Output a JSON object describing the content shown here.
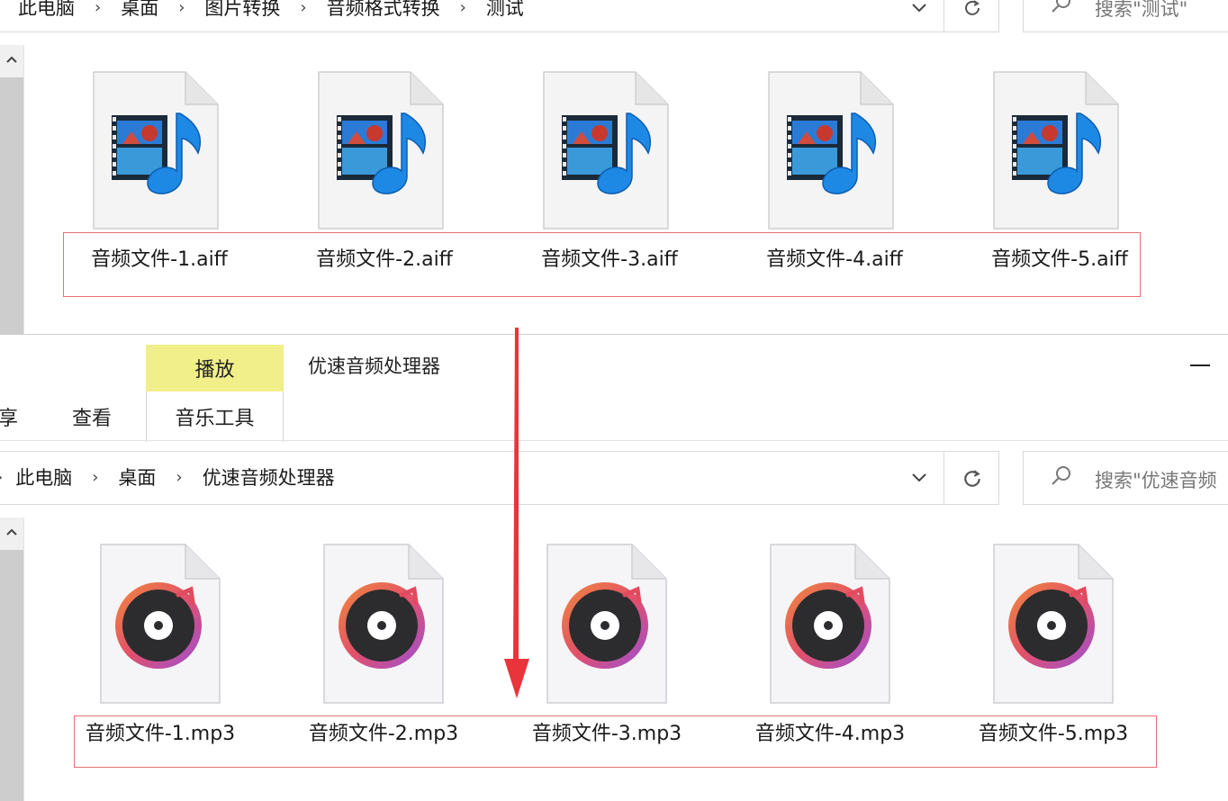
{
  "top_window": {
    "breadcrumb": [
      "此电脑",
      "桌面",
      "图片转换",
      "音频格式转换",
      "测试"
    ],
    "search_placeholder": "搜索\"测试\"",
    "files": [
      {
        "name": "音频文件-1.aiff"
      },
      {
        "name": "音频文件-2.aiff"
      },
      {
        "name": "音频文件-3.aiff"
      },
      {
        "name": "音频文件-4.aiff"
      },
      {
        "name": "音频文件-5.aiff"
      }
    ],
    "file_icon": "aiff-media-icon"
  },
  "bottom_window": {
    "ribbon": {
      "tab_share_partial": "享",
      "tab_view": "查看",
      "context_header": "播放",
      "context_tab": "音乐工具",
      "window_title": "优速音频处理器",
      "minimize_glyph": "minimize-icon"
    },
    "breadcrumb": [
      "此电脑",
      "桌面",
      "优速音频处理器"
    ],
    "search_placeholder": "搜索\"优速音频",
    "files": [
      {
        "name": "音频文件-1.mp3"
      },
      {
        "name": "音频文件-2.mp3"
      },
      {
        "name": "音频文件-3.mp3"
      },
      {
        "name": "音频文件-4.mp3"
      },
      {
        "name": "音频文件-5.mp3"
      }
    ],
    "file_icon": "music-disc-icon"
  },
  "colors": {
    "highlight_box": "#e57070",
    "arrow": "#e8343a",
    "context_header_bg": "#f1ef8a"
  }
}
